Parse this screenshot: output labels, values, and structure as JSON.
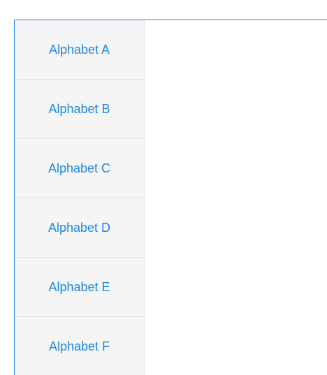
{
  "tabs": [
    {
      "label": "Alphabet A"
    },
    {
      "label": "Alphabet B"
    },
    {
      "label": "Alphabet C"
    },
    {
      "label": "Alphabet D"
    },
    {
      "label": "Alphabet E"
    },
    {
      "label": "Alphabet F"
    }
  ],
  "colors": {
    "accent": "#1e88e5",
    "tab_background": "#f5f5f5",
    "divider": "#e3e3e3"
  }
}
